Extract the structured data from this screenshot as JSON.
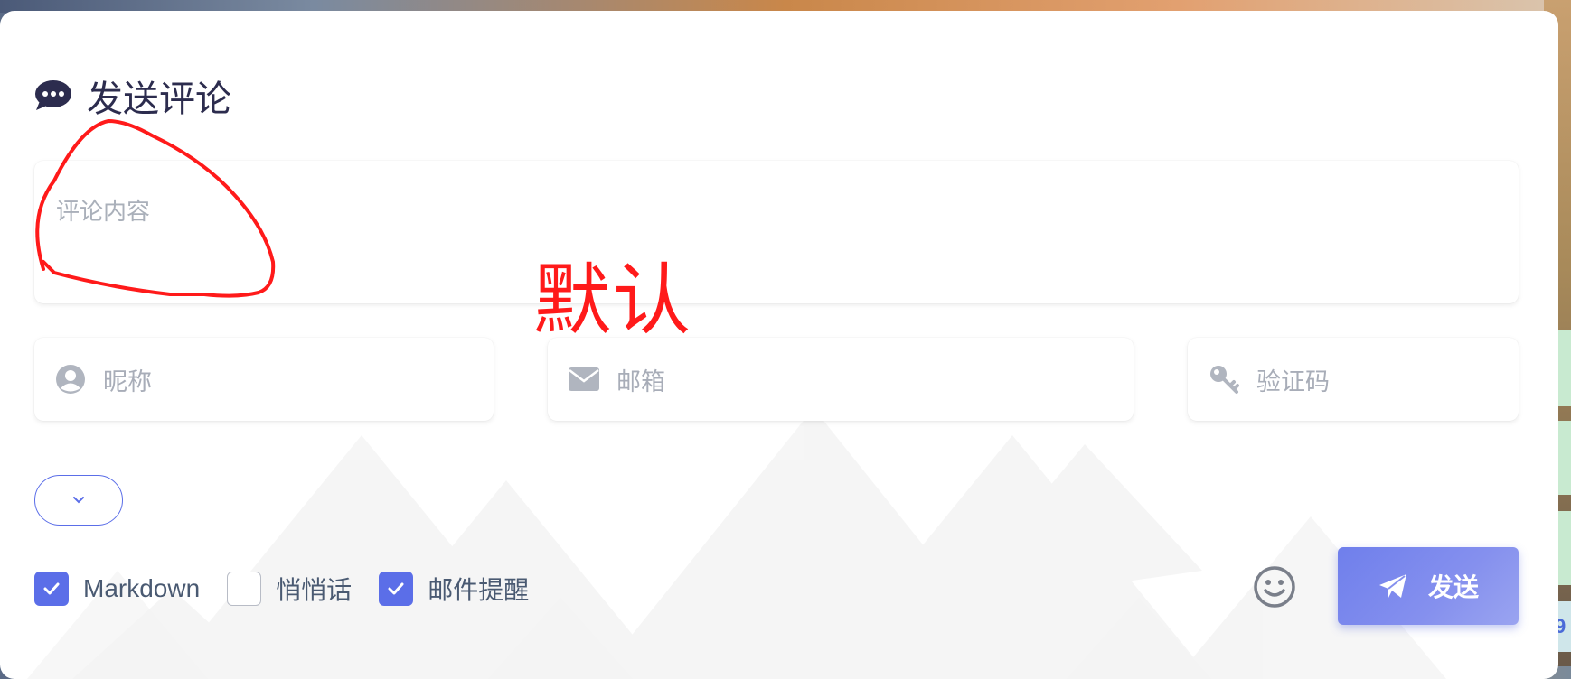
{
  "comment_form": {
    "title": "发送评论",
    "content_placeholder": "评论内容",
    "nickname_placeholder": "昵称",
    "email_placeholder": "邮箱",
    "captcha_placeholder": "验证码",
    "options": {
      "markdown": {
        "label": "Markdown",
        "checked": true
      },
      "whisper": {
        "label": "悄悄话",
        "checked": false
      },
      "email_notify": {
        "label": "邮件提醒",
        "checked": true
      }
    },
    "send_label": "发送"
  },
  "annotation": {
    "text": "默认",
    "color": "#ff1a1a"
  },
  "side_tab_number": "9",
  "accent_color": "#5b6ee8",
  "icons": [
    "comment-icon",
    "user-icon",
    "envelope-icon",
    "key-icon",
    "chevron-down-icon",
    "check-icon",
    "smile-icon",
    "paper-plane-icon"
  ]
}
